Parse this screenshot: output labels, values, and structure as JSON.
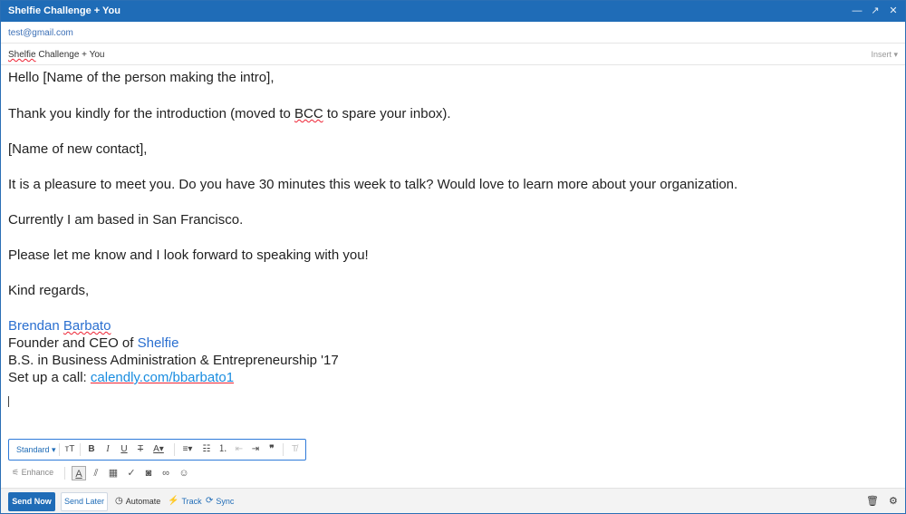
{
  "window": {
    "title": "Shelfie Challenge + You",
    "minimize_icon": "minimize-icon",
    "expand_icon": "expand-icon",
    "close_icon": "close-icon"
  },
  "to": {
    "value": "test@gmail.com"
  },
  "subject": {
    "word1": "Shelfie",
    "rest": " Challenge + You",
    "insert_label": "Insert ▾"
  },
  "body": {
    "greeting": "Hello [Name of the person making the intro],",
    "line2_a": "Thank you kindly for the introduction (moved to ",
    "line2_bcc": "BCC",
    "line2_b": " to spare your inbox).",
    "line3": "[Name of new contact],",
    "line4": "It is a pleasure to meet you. Do you have 30 minutes this week to talk? Would love to learn more about your organization.",
    "line5": "Currently I am based in San Francisco.",
    "line6": "Please let me know and I look forward to speaking with you!",
    "line7": "Kind regards,",
    "sig_first": "Brendan ",
    "sig_last": "Barbato",
    "sig_title_a": "Founder and CEO of ",
    "sig_title_company": "Shelfie",
    "sig_degree": "B.S. in Business Administration & Entrepreneurship '17",
    "sig_call_label": "Set up a call: ",
    "sig_call_link_a": "calendly.com/",
    "sig_call_link_b": "bbarbato1"
  },
  "format_toolbar": {
    "style_label": "Standard ▾",
    "icons": [
      "text-size-icon",
      "bold-icon",
      "italic-icon",
      "underline-icon",
      "strikethrough-icon",
      "font-color-icon",
      "align-icon",
      "bullet-list-icon",
      "numbered-list-icon",
      "outdent-icon",
      "indent-icon",
      "quote-icon",
      "clear-format-icon"
    ]
  },
  "tools": {
    "enhance_label": "Enhance"
  },
  "bottom": {
    "send_now": "Send Now",
    "send_later": "Send Later",
    "automate": "Automate",
    "track": "Track",
    "sync": "Sync"
  }
}
